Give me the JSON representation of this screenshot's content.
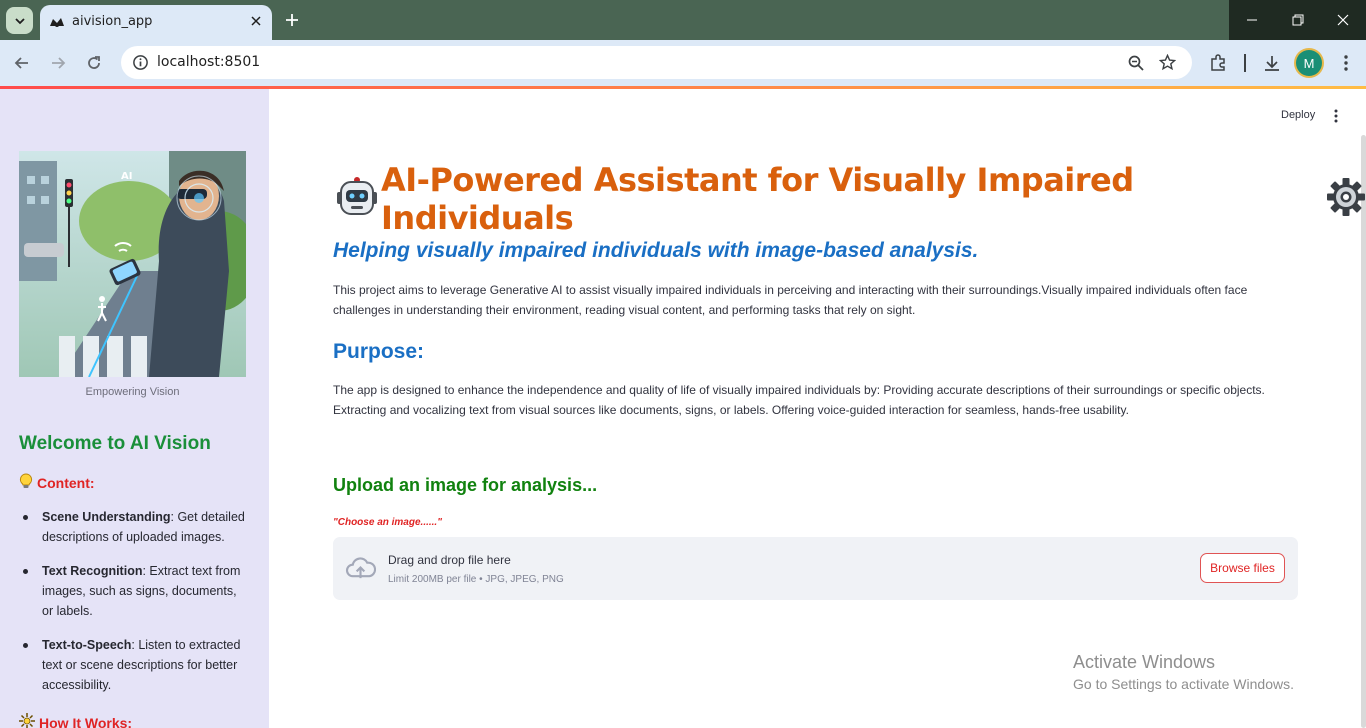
{
  "browser": {
    "tab_title": "aivision_app",
    "url": "localhost:8501",
    "profile_initial": "M"
  },
  "header": {
    "deploy_label": "Deploy"
  },
  "sidebar": {
    "image_caption": "Empowering Vision",
    "welcome": "Welcome to AI Vision",
    "content_heading": "Content:",
    "items": [
      {
        "title": "Scene Understanding",
        "text": ": Get detailed descriptions of uploaded images."
      },
      {
        "title": "Text Recognition",
        "text": ": Extract text from images, such as signs, documents, or labels."
      },
      {
        "title": "Text-to-Speech",
        "text": ": Listen to extracted text or scene descriptions for better accessibility."
      }
    ],
    "how_heading": "How It Works:"
  },
  "main": {
    "title": "AI-Powered Assistant for Visually Impaired Individuals",
    "subtitle": "Helping visually impaired individuals with image-based analysis.",
    "intro": "This project aims to leverage Generative AI to assist visually impaired individuals in perceiving and interacting with their surroundings.Visually impaired individuals often face challenges in understanding their environment, reading visual content, and performing tasks that rely on sight.",
    "purpose_heading": "Purpose:",
    "purpose_text": "The app is designed to enhance the independence and quality of life of visually impaired individuals by: Providing accurate descriptions of their surroundings or specific objects. Extracting and vocalizing text from visual sources like documents, signs, or labels. Offering voice-guided interaction for seamless, hands-free usability.",
    "upload_heading": "Upload an image for analysis...",
    "upload_hint": "\"Choose an image......\"",
    "drop_title": "Drag and drop file here",
    "drop_limit": "Limit 200MB per file • JPG, JPEG, PNG",
    "browse_label": "Browse files"
  },
  "watermark": {
    "line1": "Activate Windows",
    "line2": "Go to Settings to activate Windows."
  },
  "colors": {
    "title": "#d9600d",
    "subtitle": "#1a6fc4",
    "upload_heading": "#11820f",
    "accent_red": "#e02424",
    "sidebar_bg": "#e5e3f7"
  },
  "icons": [
    "tab-list-icon",
    "streamlit-favicon",
    "close-icon",
    "plus-icon",
    "minimize-icon",
    "restore-icon",
    "back-icon",
    "forward-icon",
    "reload-icon",
    "info-icon",
    "zoom-icon",
    "star-icon",
    "extensions-icon",
    "download-icon",
    "kebab-icon",
    "robot-emoji",
    "gear-emoji",
    "lightbulb-emoji",
    "sparkle-emoji",
    "cloud-upload-icon"
  ]
}
